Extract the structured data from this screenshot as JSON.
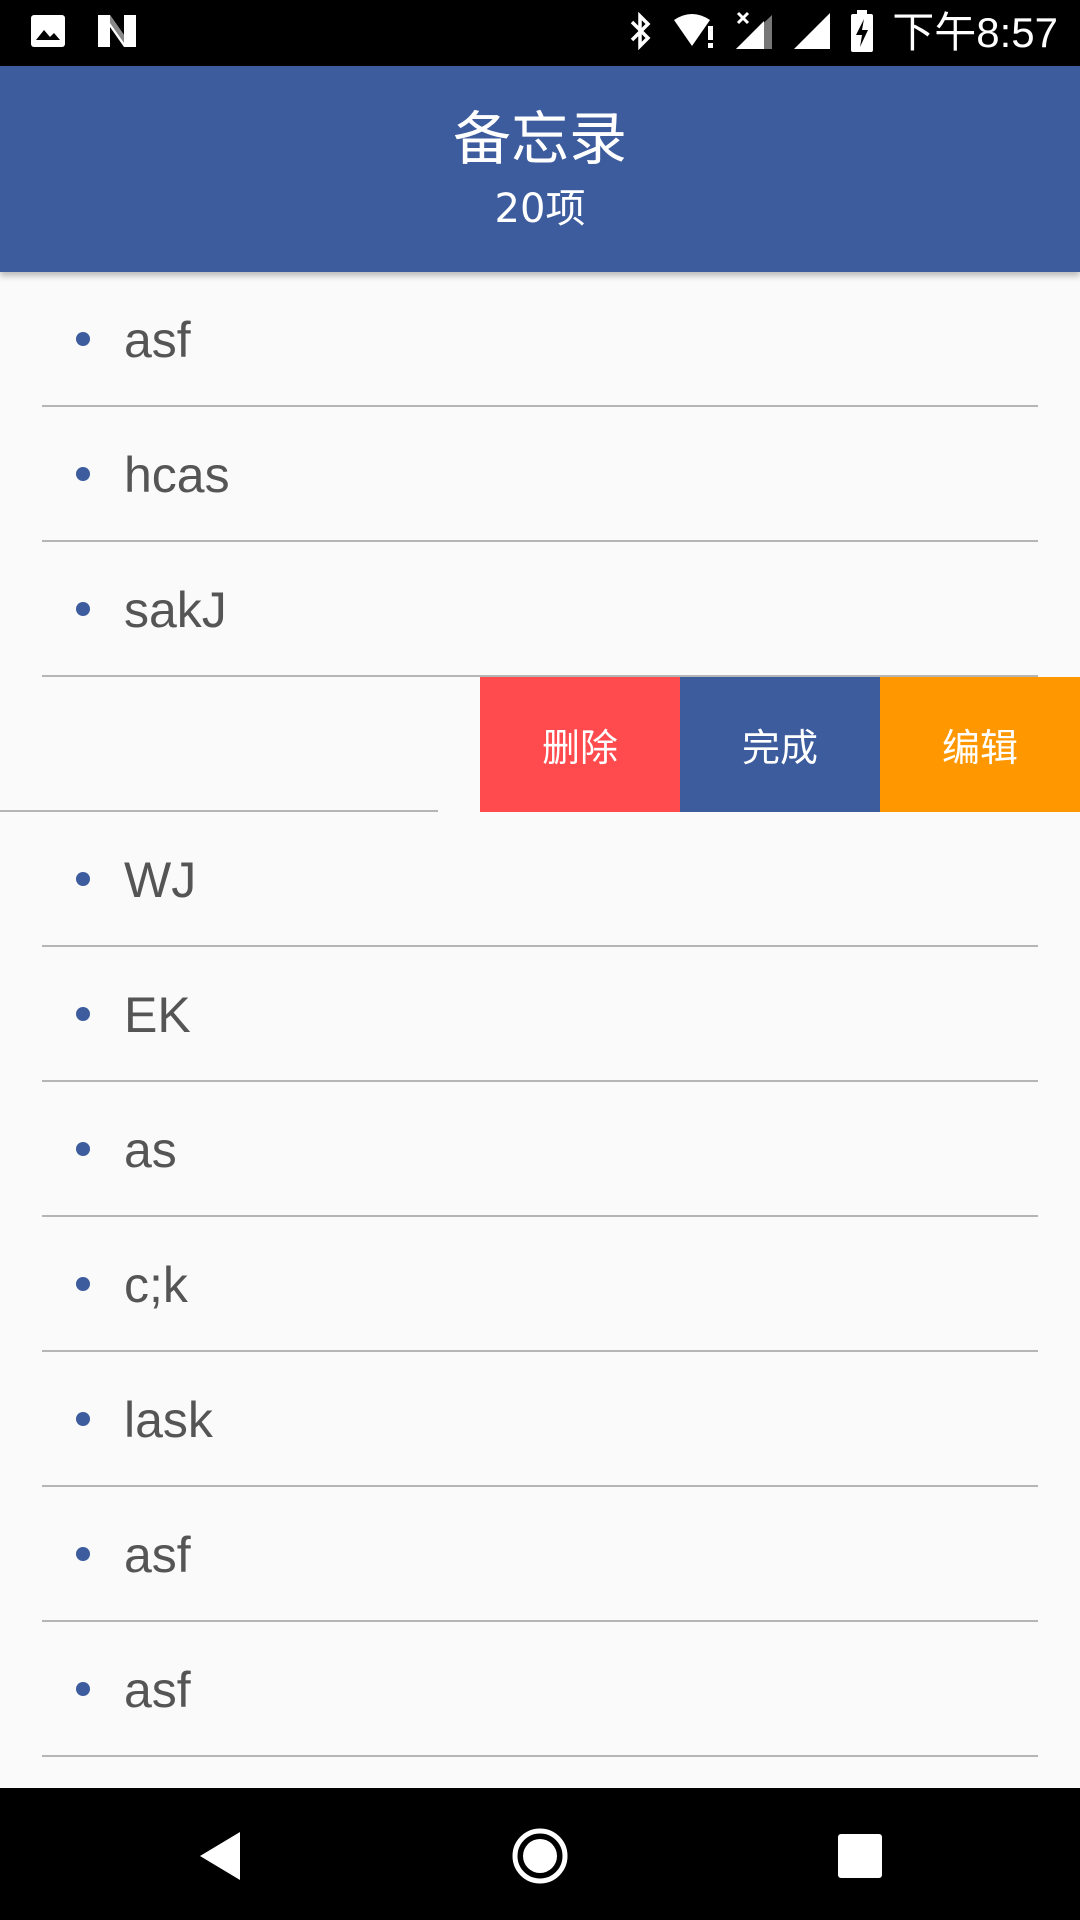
{
  "status_bar": {
    "time": "下午8:57",
    "left_icons": [
      "image-icon",
      "n-icon"
    ],
    "right_icons": [
      "bluetooth-icon",
      "wifi-alert-icon",
      "signal-no-sim-icon",
      "signal-icon",
      "battery-charging-icon"
    ]
  },
  "app_bar": {
    "title": "备忘录",
    "subtitle": "20项"
  },
  "list": {
    "items": [
      {
        "text": "asf"
      },
      {
        "text": "hcas"
      },
      {
        "text": "sakJ"
      },
      {
        "text": ""
      },
      {
        "text": "WJ"
      },
      {
        "text": "EK"
      },
      {
        "text": "as"
      },
      {
        "text": "c;k"
      },
      {
        "text": "lask"
      },
      {
        "text": "asf"
      },
      {
        "text": "asf"
      }
    ],
    "swipe_actions": {
      "delete": "删除",
      "done": "完成",
      "edit": "编辑"
    }
  },
  "nav_bar": {
    "buttons": [
      "back-icon",
      "home-icon",
      "recents-icon"
    ]
  },
  "colors": {
    "primary": "#3D5C9E",
    "delete": "#FF4B4E",
    "edit": "#FF9800",
    "background": "#FAFAFA"
  }
}
